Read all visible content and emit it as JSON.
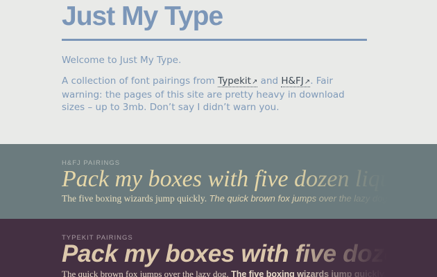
{
  "header": {
    "title": "Just My Type",
    "welcome": "Welcome to Just My Type.",
    "intro_before": "A collection of font pairings from ",
    "link_typekit": "Typekit",
    "intro_and": " and ",
    "link_hfj": "H&FJ",
    "intro_after": ". Fair warning: the pages of this site are pretty heavy in download sizes – up to 3mb. Don’t say I didn’t warn you.",
    "external_icon": "↗"
  },
  "hfj_section": {
    "kicker": "H&FJ Pairings",
    "display": "Pack my boxes with five dozen liquor jugs.",
    "sub_primary": "The five boxing wizards jump quickly. ",
    "sub_secondary": "The quick brown fox jumps over the lazy dog."
  },
  "typekit_section": {
    "kicker": "Typekit Pairings",
    "display": "Pack my boxes with five dozen",
    "sub_primary": "The quick brown fox jumps over the lazy dog. ",
    "sub_secondary": "The five boxing wizards jump quickly."
  },
  "colors": {
    "accent": "#7b96b8",
    "hfj_band": "#6b7b7e",
    "typekit_band": "#443042"
  }
}
